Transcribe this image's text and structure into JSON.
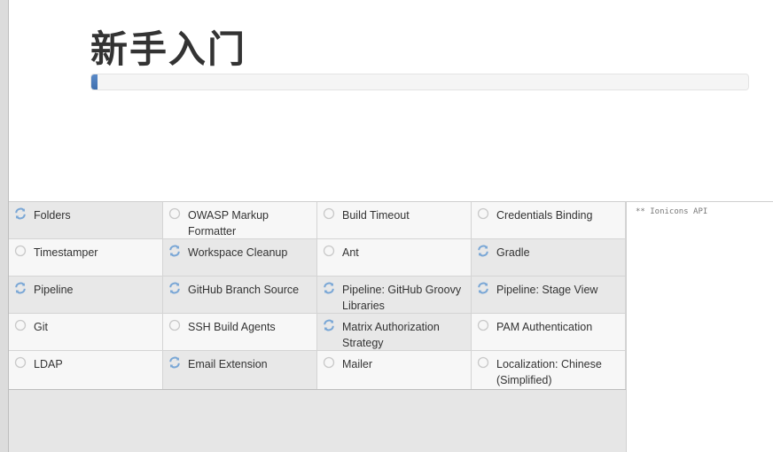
{
  "header": {
    "title": "新手入门",
    "progress_percent": 1
  },
  "plugins": [
    {
      "label": "Folders",
      "status": "installing"
    },
    {
      "label": "OWASP Markup Formatter",
      "status": "pending"
    },
    {
      "label": "Build Timeout",
      "status": "pending"
    },
    {
      "label": "Credentials Binding",
      "status": "pending"
    },
    {
      "label": "Timestamper",
      "status": "pending"
    },
    {
      "label": "Workspace Cleanup",
      "status": "installing"
    },
    {
      "label": "Ant",
      "status": "pending"
    },
    {
      "label": "Gradle",
      "status": "installing"
    },
    {
      "label": "Pipeline",
      "status": "installing"
    },
    {
      "label": "GitHub Branch Source",
      "status": "installing"
    },
    {
      "label": "Pipeline: GitHub Groovy Libraries",
      "status": "installing"
    },
    {
      "label": "Pipeline: Stage View",
      "status": "installing"
    },
    {
      "label": "Git",
      "status": "pending"
    },
    {
      "label": "SSH Build Agents",
      "status": "pending"
    },
    {
      "label": "Matrix Authorization Strategy",
      "status": "installing"
    },
    {
      "label": "PAM Authentication",
      "status": "pending"
    },
    {
      "label": "LDAP",
      "status": "pending"
    },
    {
      "label": "Email Extension",
      "status": "installing"
    },
    {
      "label": "Mailer",
      "status": "pending"
    },
    {
      "label": "Localization: Chinese (Simplified)",
      "status": "pending"
    }
  ],
  "log": {
    "text": "** Ionicons API"
  },
  "colors": {
    "installing_icon": "#7aa7d6",
    "pending_icon": "#c9c9c9",
    "progress": "#4a7bbd"
  }
}
